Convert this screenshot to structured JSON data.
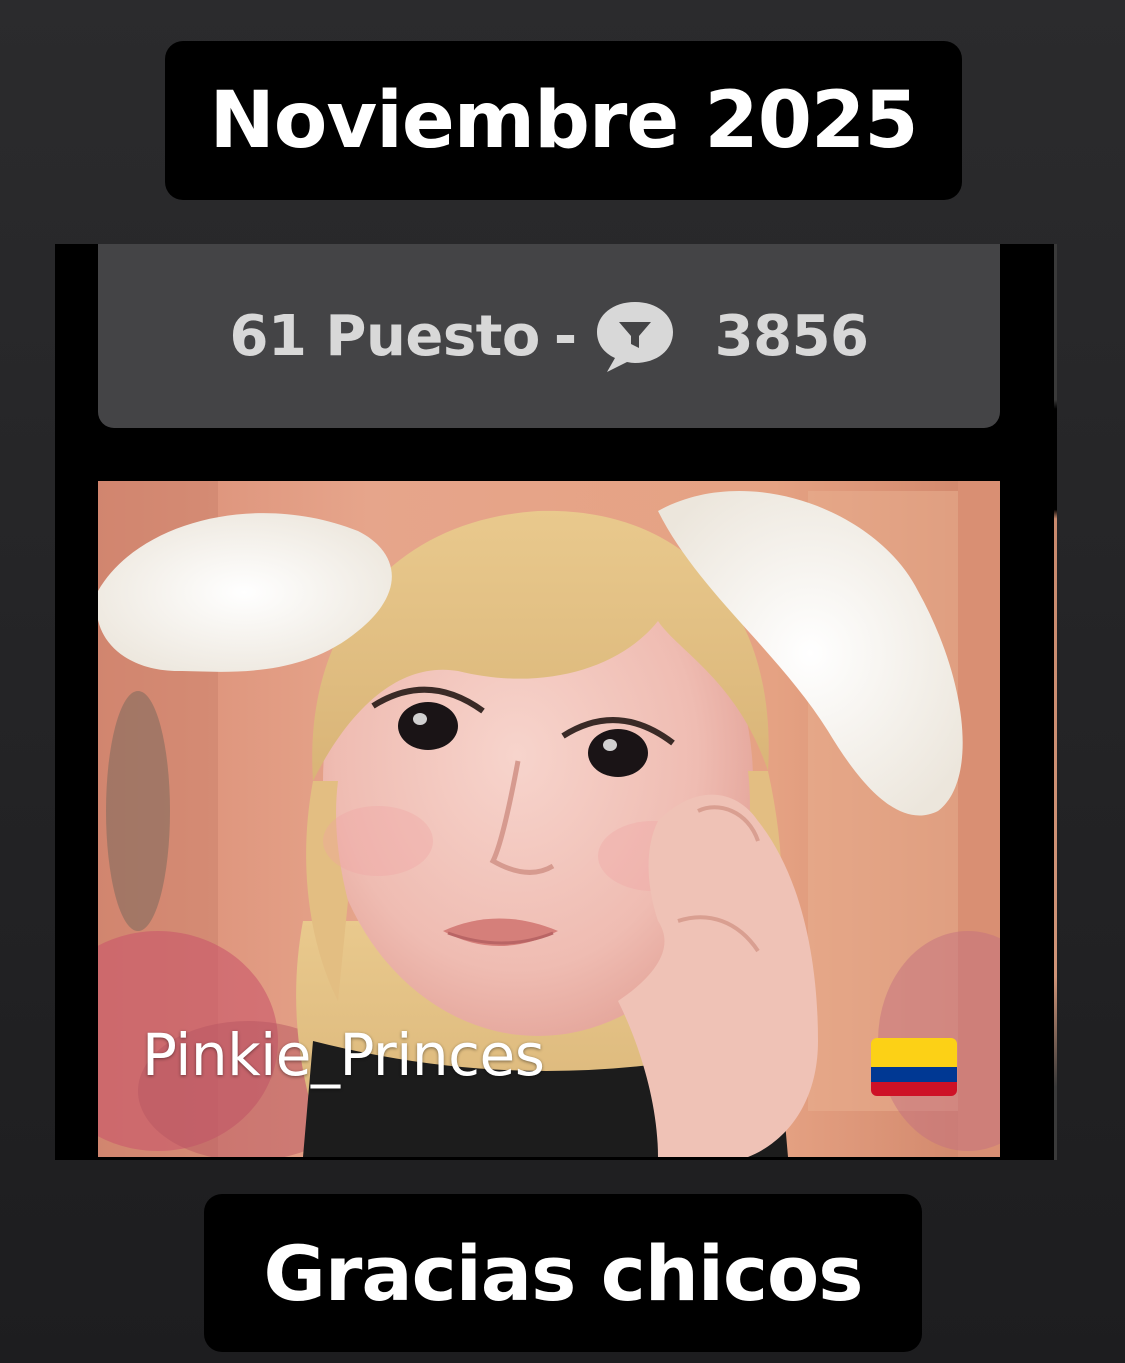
{
  "top_caption": "Noviembre 2025",
  "rank_card": {
    "position": "61 Puesto",
    "separator": "-",
    "icon": "chat-bubble-icon",
    "score": "3856"
  },
  "model_card": {
    "username": "Pinkie_Princes",
    "flag_icon": "colombia-flag-icon",
    "flag_colors": [
      "#FCD116",
      "#003893",
      "#CE1126"
    ]
  },
  "bottom_caption": "Gracias chicos",
  "colors": {
    "caption_background": "#000000",
    "caption_text": "#ffffff",
    "rank_card_background": "#444446",
    "rank_card_text": "#d8d8d8"
  }
}
